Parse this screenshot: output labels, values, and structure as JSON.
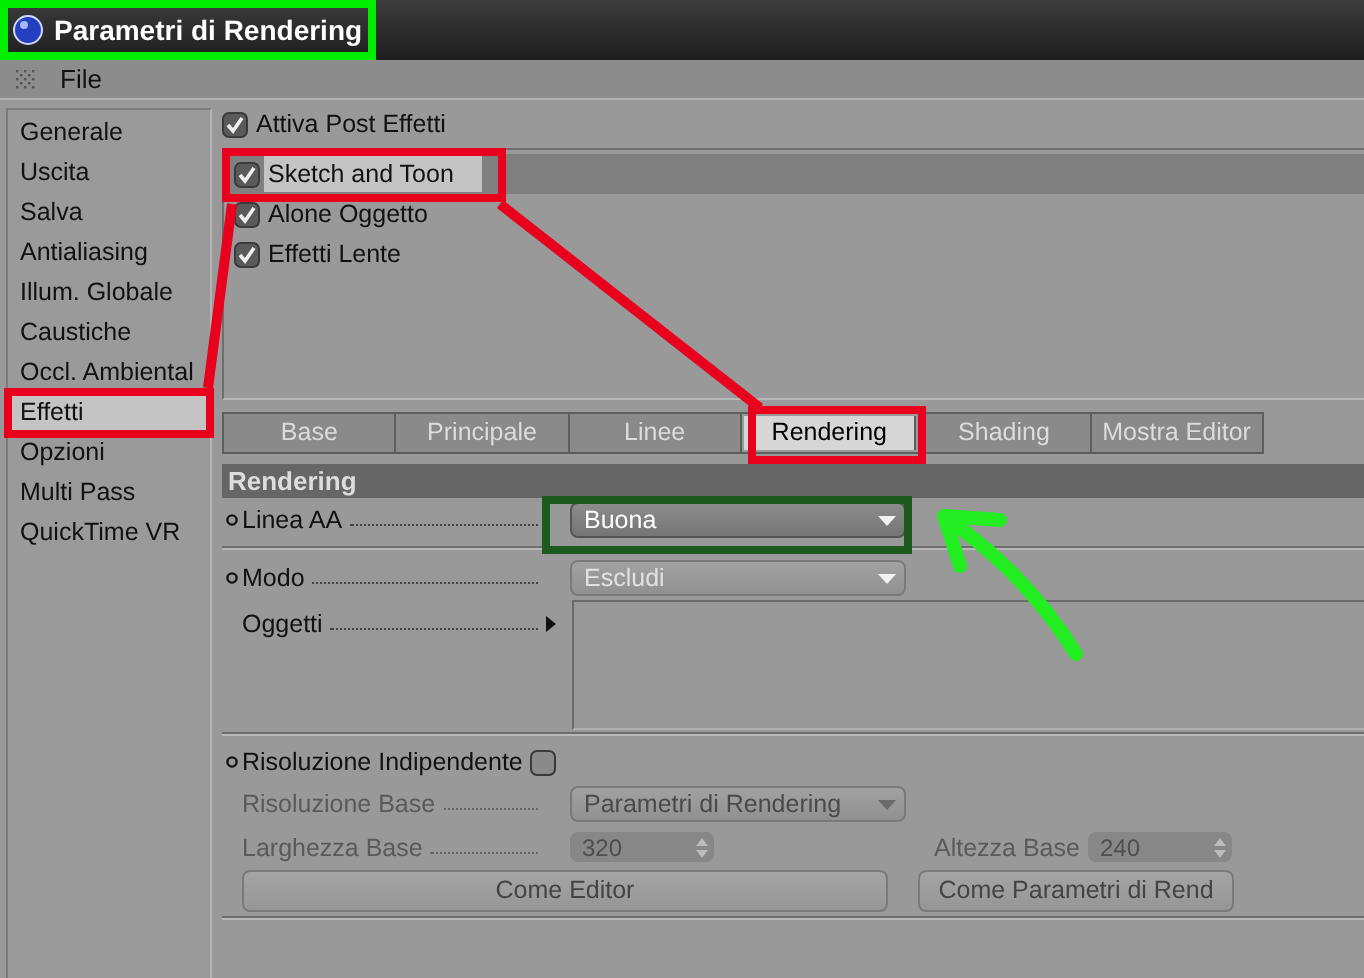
{
  "window": {
    "title": "Parametri di Rendering"
  },
  "menu": [
    "File"
  ],
  "sidebar": {
    "items": [
      {
        "label": "Generale",
        "selected": false
      },
      {
        "label": "Uscita",
        "selected": false
      },
      {
        "label": "Salva",
        "selected": false
      },
      {
        "label": "Antialiasing",
        "selected": false
      },
      {
        "label": "Illum. Globale",
        "selected": false
      },
      {
        "label": "Caustiche",
        "selected": false
      },
      {
        "label": "Occl. Ambiental",
        "selected": false
      },
      {
        "label": "Effetti",
        "selected": true
      },
      {
        "label": "Opzioni",
        "selected": false
      },
      {
        "label": "Multi Pass",
        "selected": false
      },
      {
        "label": "QuickTime VR",
        "selected": false
      }
    ]
  },
  "post_effects": {
    "master": {
      "label": "Attiva Post Effetti",
      "checked": true
    },
    "items": [
      {
        "label": "Sketch and Toon",
        "checked": true,
        "selected": true
      },
      {
        "label": "Alone Oggetto",
        "checked": true,
        "selected": false
      },
      {
        "label": "Effetti Lente",
        "checked": true,
        "selected": false
      }
    ]
  },
  "tabs": [
    {
      "label": "Base",
      "selected": false
    },
    {
      "label": "Principale",
      "selected": false
    },
    {
      "label": "Linee",
      "selected": false
    },
    {
      "label": "Rendering",
      "selected": true
    },
    {
      "label": "Shading",
      "selected": false
    },
    {
      "label": "Mostra Editor",
      "selected": false
    }
  ],
  "section": {
    "title": "Rendering",
    "rows": [
      {
        "kind": "dropdown",
        "label": "Linea AA",
        "bullet": true,
        "value": "Buona",
        "focused": true,
        "disabled": false
      },
      {
        "kind": "separator"
      },
      {
        "kind": "dropdown",
        "label": "Modo",
        "bullet": true,
        "value": "Escludi",
        "focused": false,
        "disabled": false
      },
      {
        "kind": "list",
        "label": "Oggetti",
        "bullet": false
      },
      {
        "kind": "separator"
      },
      {
        "kind": "checkbox",
        "label": "Risoluzione Indipendente",
        "bullet": true,
        "checked": false
      },
      {
        "kind": "dropdown",
        "label": "Risoluzione Base",
        "bullet": false,
        "value": "Parametri di Rendering",
        "focused": false,
        "disabled": true
      },
      {
        "kind": "number_pair",
        "disabled": true,
        "fields": [
          {
            "label": "Larghezza Base",
            "value": "320"
          },
          {
            "label": "Altezza Base",
            "value": "240"
          }
        ]
      },
      {
        "kind": "buttons",
        "disabled": true,
        "buttons": [
          "Come Editor",
          "Come Parametri di Rend"
        ]
      },
      {
        "kind": "separator"
      }
    ]
  }
}
